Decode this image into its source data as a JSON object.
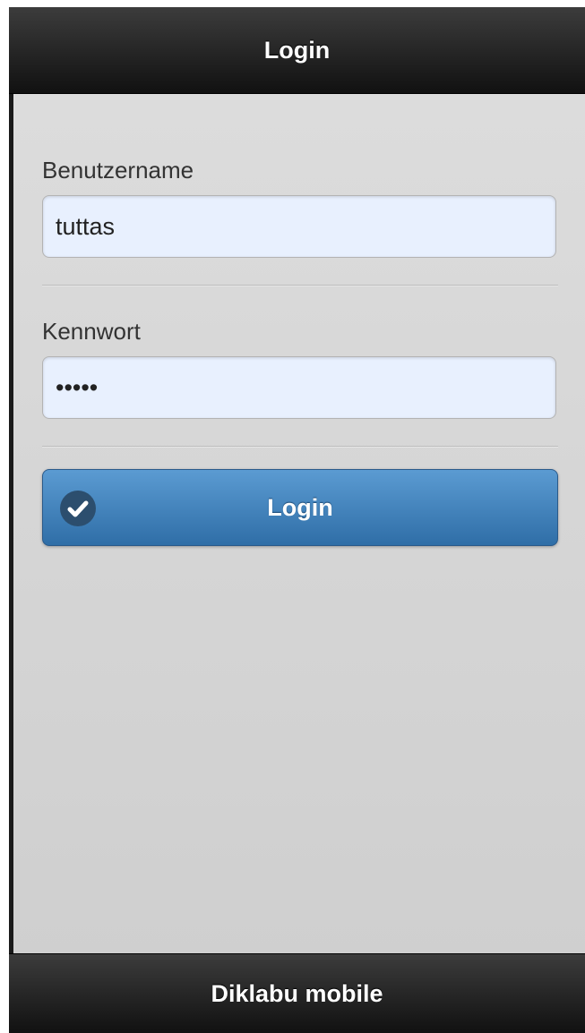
{
  "header": {
    "title": "Login"
  },
  "form": {
    "username": {
      "label": "Benutzername",
      "value": "tuttas"
    },
    "password": {
      "label": "Kennwort",
      "value": "*****"
    },
    "submit": {
      "label": "Login",
      "icon": "check-icon"
    }
  },
  "footer": {
    "title": "Diklabu mobile"
  },
  "colors": {
    "bar_background": "#1a1a1a",
    "content_background": "#d6d6d6",
    "input_background": "#e8f0fe",
    "button_accent": "#3f80b9"
  }
}
